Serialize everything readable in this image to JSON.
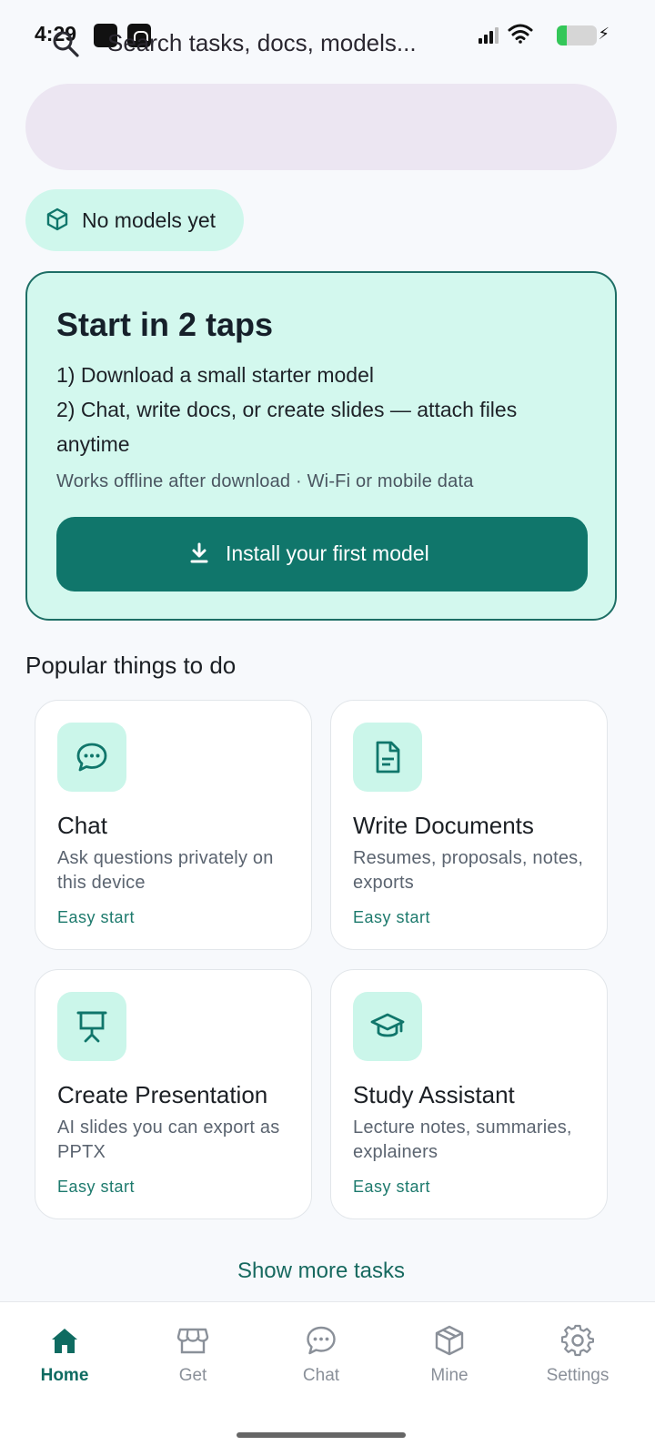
{
  "status_bar": {
    "time": "4:29",
    "battery_level": 0.25,
    "accent_battery": "#34c759"
  },
  "search": {
    "placeholder": "Search tasks, docs, models...",
    "icon": "search-icon"
  },
  "chip": {
    "label": "No models yet",
    "icon": "cube-icon"
  },
  "hero": {
    "title": "Start in 2 taps",
    "step1": "1) Download a small starter model",
    "step2": "2) Chat, write docs, or create slides — attach files anytime",
    "note": "Works offline after download · Wi-Fi or mobile data",
    "button_label": "Install your first model",
    "button_icon": "download-icon"
  },
  "section": {
    "title": "Popular things to do"
  },
  "tasks": [
    {
      "title": "Chat",
      "desc": "Ask questions privately on this device",
      "tag": "Easy start",
      "icon": "chat-bubble-icon"
    },
    {
      "title": "Write Documents",
      "desc": "Resumes, proposals, notes, exports",
      "tag": "Easy start",
      "icon": "document-icon"
    },
    {
      "title": "Create Presentation",
      "desc": "AI slides you can export as PPTX",
      "tag": "Easy start",
      "icon": "presentation-icon"
    },
    {
      "title": "Study Assistant",
      "desc": "Lecture notes, summaries, explainers",
      "tag": "Easy start",
      "icon": "graduation-cap-icon"
    }
  ],
  "show_more": "Show more tasks",
  "nav": [
    {
      "label": "Home",
      "icon": "home-icon",
      "active": true
    },
    {
      "label": "Get",
      "icon": "store-icon",
      "active": false
    },
    {
      "label": "Chat",
      "icon": "chat-icon",
      "active": false
    },
    {
      "label": "Mine",
      "icon": "box-icon",
      "active": false
    },
    {
      "label": "Settings",
      "icon": "gear-icon",
      "active": false
    }
  ],
  "colors": {
    "accent": "#10766b",
    "hero_bg": "#d3f8ee",
    "search_bg": "#ece6f2"
  }
}
